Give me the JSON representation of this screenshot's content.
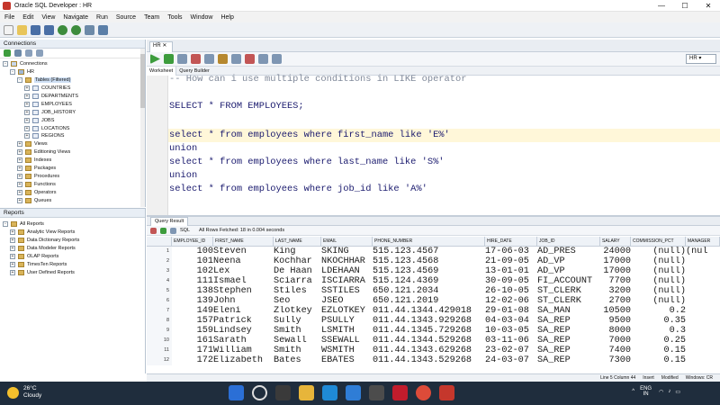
{
  "window": {
    "title": "Oracle SQL Developer : HR",
    "controls": [
      "—",
      "☐",
      "✕"
    ]
  },
  "menu": [
    "File",
    "Edit",
    "View",
    "Navigate",
    "Run",
    "Source",
    "Team",
    "Tools",
    "Window",
    "Help"
  ],
  "connections": {
    "title": "Connections",
    "root": "Connections",
    "hr": "HR",
    "tables": "Tables (Filtered)",
    "table_items": [
      "COUNTRIES",
      "DEPARTMENTS",
      "EMPLOYEES",
      "JOB_HISTORY",
      "JOBS",
      "LOCATIONS",
      "REGIONS"
    ],
    "other_items": [
      "Views",
      "Editioning Views",
      "Indexes",
      "Packages",
      "Procedures",
      "Functions",
      "Operators",
      "Queues"
    ]
  },
  "reports": {
    "title": "Reports",
    "items": [
      "All Reports",
      "Analytic View Reports",
      "Data Dictionary Reports",
      "Data Modeler Reports",
      "OLAP Reports",
      "TimesTen Reports",
      "User Defined Reports"
    ]
  },
  "editor": {
    "tab": "HR",
    "connection": "HR",
    "tabs": [
      "Worksheet",
      "Query Builder"
    ],
    "lines": [
      "-- How can i use multiple conditions in LIKE operator",
      "",
      "SELECT * FROM EMPLOYEES;",
      "",
      "select * from employees where first_name like 'E%'",
      "union",
      "select * from employees where last_name like 'S%'",
      "union",
      "select * from employees where job_id like 'A%'"
    ]
  },
  "results": {
    "tab": "Query Result",
    "sql": "SQL",
    "fetched": "All Rows Fetched: 18 in 0.004 seconds",
    "columns": [
      "EMPLOYEE_ID",
      "FIRST_NAME",
      "LAST_NAME",
      "EMAIL",
      "PHONE_NUMBER",
      "HIRE_DATE",
      "JOB_ID",
      "SALARY",
      "COMMISSION_PCT",
      "MANAGER"
    ],
    "rows": [
      [
        "1",
        "100",
        "Steven",
        "King",
        "SKING",
        "515.123.4567",
        "17-06-03",
        "AD_PRES",
        "24000",
        "(null)",
        "(nul"
      ],
      [
        "2",
        "101",
        "Neena",
        "Kochhar",
        "NKOCHHAR",
        "515.123.4568",
        "21-09-05",
        "AD_VP",
        "17000",
        "(null)",
        ""
      ],
      [
        "3",
        "102",
        "Lex",
        "De Haan",
        "LDEHAAN",
        "515.123.4569",
        "13-01-01",
        "AD_VP",
        "17000",
        "(null)",
        ""
      ],
      [
        "4",
        "111",
        "Ismael",
        "Sciarra",
        "ISCIARRA",
        "515.124.4369",
        "30-09-05",
        "FI_ACCOUNT",
        "7700",
        "(null)",
        ""
      ],
      [
        "5",
        "138",
        "Stephen",
        "Stiles",
        "SSTILES",
        "650.121.2034",
        "26-10-05",
        "ST_CLERK",
        "3200",
        "(null)",
        ""
      ],
      [
        "6",
        "139",
        "John",
        "Seo",
        "JSEO",
        "650.121.2019",
        "12-02-06",
        "ST_CLERK",
        "2700",
        "(null)",
        ""
      ],
      [
        "7",
        "149",
        "Eleni",
        "Zlotkey",
        "EZLOTKEY",
        "011.44.1344.429018",
        "29-01-08",
        "SA_MAN",
        "10500",
        "0.2",
        ""
      ],
      [
        "8",
        "157",
        "Patrick",
        "Sully",
        "PSULLY",
        "011.44.1343.929268",
        "04-03-04",
        "SA_REP",
        "9500",
        "0.35",
        ""
      ],
      [
        "9",
        "159",
        "Lindsey",
        "Smith",
        "LSMITH",
        "011.44.1345.729268",
        "10-03-05",
        "SA_REP",
        "8000",
        "0.3",
        ""
      ],
      [
        "10",
        "161",
        "Sarath",
        "Sewall",
        "SSEWALL",
        "011.44.1344.529268",
        "03-11-06",
        "SA_REP",
        "7000",
        "0.25",
        ""
      ],
      [
        "11",
        "171",
        "William",
        "Smith",
        "WSMITH",
        "011.44.1343.629268",
        "23-02-07",
        "SA_REP",
        "7400",
        "0.15",
        ""
      ],
      [
        "12",
        "172",
        "Elizabeth",
        "Bates",
        "EBATES",
        "011.44.1343.529268",
        "24-03-07",
        "SA_REP",
        "7300",
        "0.15",
        ""
      ]
    ]
  },
  "status": {
    "position": "Line 5 Column 44",
    "mode": "Insert",
    "modified": "Modified",
    "eol": "Windows: CR"
  },
  "taskbar": {
    "temp": "26°C",
    "weather": "Cloudy",
    "lang1": "ENG",
    "lang2": "IN"
  },
  "colors": {
    "accent": "#2f6fb3",
    "highlight": "#fff7d9",
    "taskbar": "#1f2d3d"
  }
}
